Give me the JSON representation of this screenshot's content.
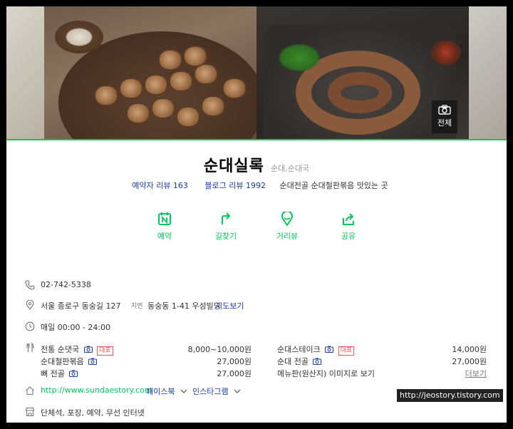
{
  "photo_viewer": {
    "all_label": "전체"
  },
  "place": {
    "name": "순대실록",
    "category": "순대,순대국",
    "visitor_review": "예약자 리뷰 163",
    "blog_review": "블로그 리뷰 1992",
    "description": "순대전골 순대철판볶음 맛있는 곳"
  },
  "actions": [
    {
      "label": "예약",
      "icon": "reservation-icon"
    },
    {
      "label": "길찾기",
      "icon": "directions-icon"
    },
    {
      "label": "거리뷰",
      "icon": "street-view-icon"
    },
    {
      "label": "공유",
      "icon": "share-icon"
    }
  ],
  "info": {
    "phone": "02-742-5338",
    "address": "서울 종로구 동숭길 127",
    "jibun_label": "지번",
    "jibun_address": "동숭동 1-41 우성빌딩",
    "map_link": "지도보기",
    "hours": "매일 00:00 - 24:00",
    "menu_rep_badge": "대표",
    "menu": [
      {
        "name": "전통 순댓국",
        "price": "8,000~10,000원",
        "photo": true,
        "rep": true
      },
      {
        "name": "순대철판볶음",
        "price": "27,000원",
        "photo": true,
        "rep": false
      },
      {
        "name": "뼈 전골",
        "price": "27,000원",
        "photo": true,
        "rep": false
      },
      {
        "name": "순대스테이크",
        "price": "14,000원",
        "photo": true,
        "rep": true
      },
      {
        "name": "순대 전골",
        "price": "27,000원",
        "photo": true,
        "rep": false
      }
    ],
    "menu_board_link": "메뉴판(원산지) 이미지로 보기",
    "more_link": "더보기",
    "homepage": "http://www.sundaestory.com",
    "facebook": "페이스북",
    "instagram": "인스타그램",
    "amenities": "단체석, 포장, 예약, 무선 인터넷"
  },
  "watermark": "http://jeostory.tistory.com",
  "colors": {
    "accent": "#03c75a",
    "link": "#1a3da0",
    "badge": "#ee5555"
  }
}
